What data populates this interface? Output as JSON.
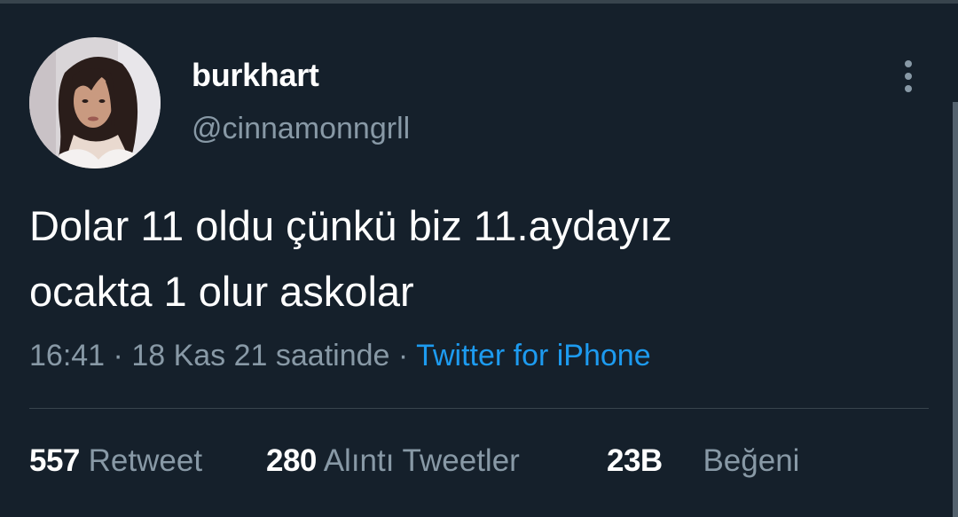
{
  "tweet": {
    "display_name": "burkhart",
    "handle": "@cinnamonngrll",
    "text_lines": [
      "Dolar 11 oldu çünkü biz 11.aydayız",
      "ocakta 1 olur askolar"
    ],
    "time": "16:41",
    "separator": "·",
    "date": "18 Kas 21 saatinde",
    "source": "Twitter for iPhone"
  },
  "stats": {
    "retweets": {
      "count": "557",
      "label": "Retweet"
    },
    "quotes": {
      "count": "280",
      "label": "Alıntı Tweetler"
    },
    "likes": {
      "count": "23B",
      "label": "Beğeni"
    }
  },
  "icons": {
    "more": "more-vertical-icon"
  },
  "colors": {
    "background": "#15202b",
    "secondary_text": "#8899a6",
    "link": "#1d9bf0",
    "divider": "#38444d"
  }
}
